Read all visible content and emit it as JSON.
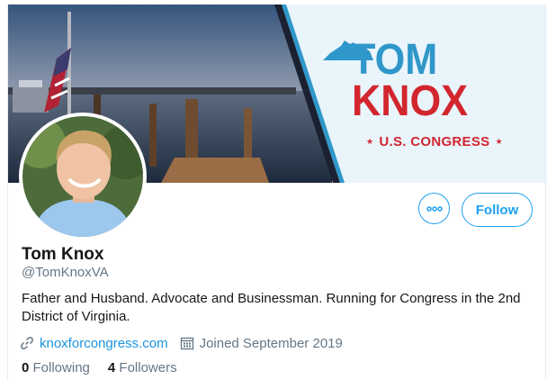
{
  "banner": {
    "brand_first": "TOM",
    "brand_last": "KNOX",
    "brand_tag": "U.S. CONGRESS",
    "state_icon": "virginia-outline-icon",
    "colors": {
      "blue": "#2f97c9",
      "red": "#d2262f",
      "background": "#e9f4fb"
    }
  },
  "profile": {
    "display_name": "Tom Knox",
    "handle": "@TomKnoxVA",
    "bio": "Father and Husband. Advocate and Businessman. Running for Congress in the 2nd District of Virginia.",
    "website": "knoxforcongress.com",
    "joined": "Joined September 2019",
    "following_count": "0",
    "following_label": "Following",
    "followers_count": "4",
    "followers_label": "Followers"
  },
  "actions": {
    "more_icon": "ellipsis-icon",
    "follow_label": "Follow"
  },
  "theme": {
    "accent": "#1da1f2",
    "link": "#1b95e0",
    "muted": "#657786",
    "text": "#14171a"
  }
}
